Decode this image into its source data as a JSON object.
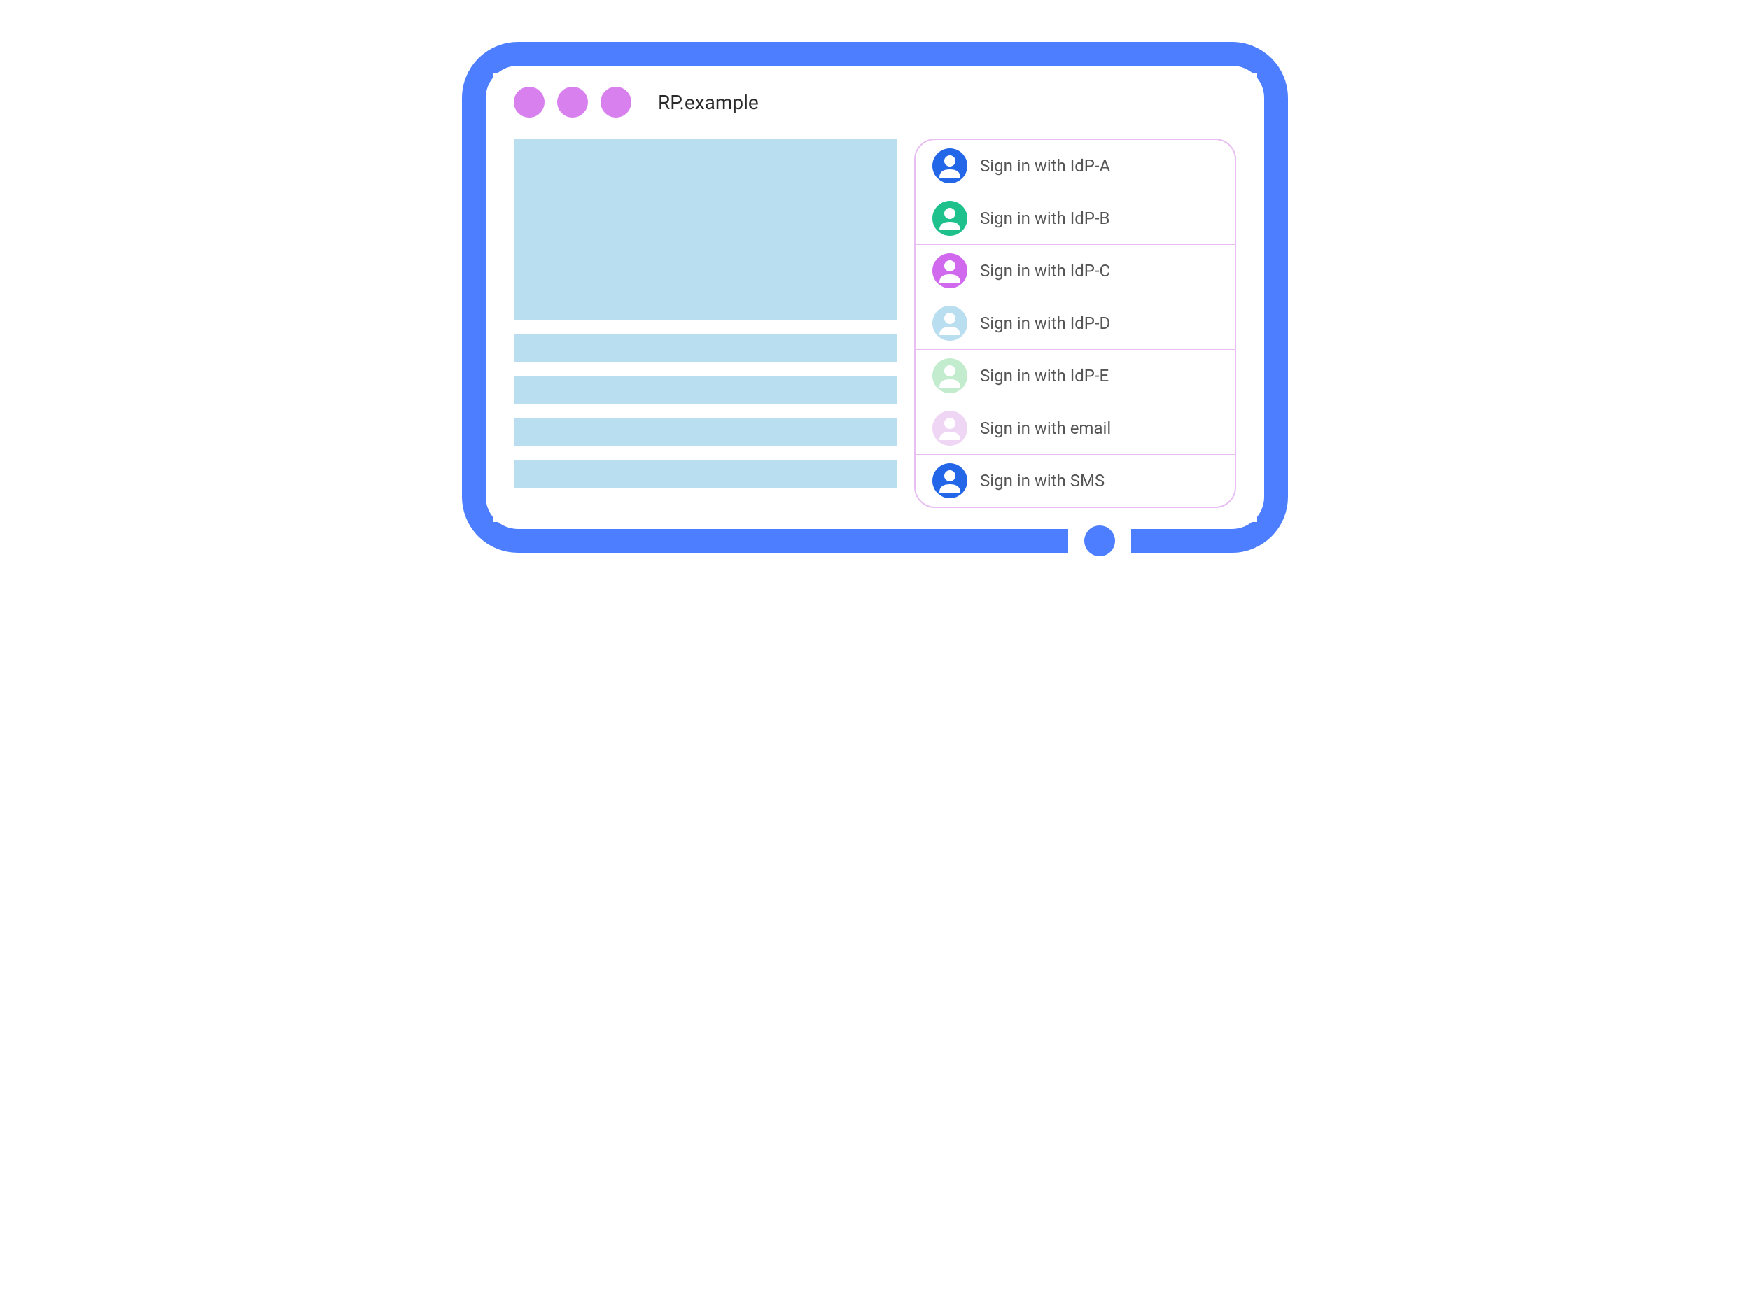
{
  "browser": {
    "url": "RP.example"
  },
  "signin_options": [
    {
      "label": "Sign in with IdP-A",
      "color": "#2466e8"
    },
    {
      "label": "Sign in with IdP-B",
      "color": "#1ec18b"
    },
    {
      "label": "Sign in with IdP-C",
      "color": "#d069ee"
    },
    {
      "label": "Sign in with IdP-D",
      "color": "#b9def0"
    },
    {
      "label": "Sign in with IdP-E",
      "color": "#c3eccf"
    },
    {
      "label": "Sign in with email",
      "color": "#f0d6f5"
    },
    {
      "label": "Sign in with SMS",
      "color": "#2466e8"
    }
  ],
  "colors": {
    "frame": "#4d7eff",
    "window_dots": "#d980ef",
    "placeholder": "#b9def0",
    "panel_border": "#e7bdf2"
  }
}
